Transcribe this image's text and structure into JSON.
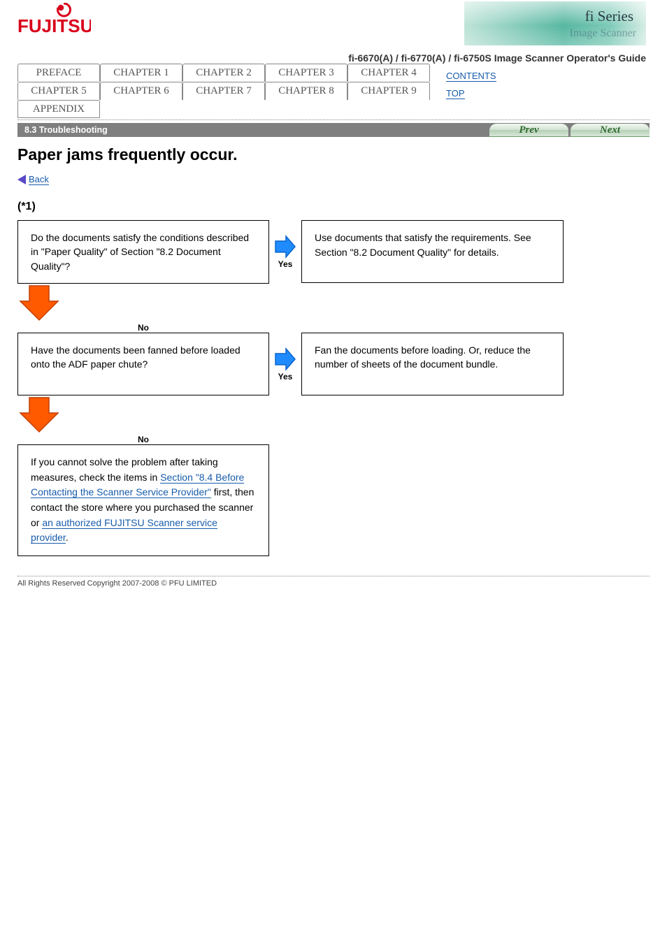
{
  "header": {
    "brand_text": "FUJITSU",
    "fiseries_brand": "fi Series",
    "fiseries_sub": "Image Scanner",
    "manual_title": "fi-6670(A) / fi-6770(A) / fi-6750S Image Scanner Operator's Guide"
  },
  "tabs": [
    "PREFACE",
    "CHAPTER 1",
    "CHAPTER 2",
    "CHAPTER 3",
    "CHAPTER 4",
    "CHAPTER 5",
    "CHAPTER 6",
    "CHAPTER 7",
    "CHAPTER 8",
    "CHAPTER 9",
    "APPENDIX"
  ],
  "side_links": {
    "contents": "CONTENTS",
    "top": "TOP"
  },
  "bar": {
    "title": "8.3 Troubleshooting",
    "prev": "Prev",
    "next": "Next"
  },
  "page": {
    "heading": "Paper jams frequently occur.",
    "back_label": "Back",
    "question_label": "(*1)",
    "box1_q": "Do the documents satisfy the conditions described in \"Paper Quality\" of Section \"8.2 Document Quality\"?",
    "box1_yes": "Yes",
    "box1_a": "Use documents that satisfy the requirements. See Section \"8.2 Document Quality\" for details.",
    "box1_no": "No",
    "box2_q": "Have the documents been fanned before loaded onto the ADF paper chute?",
    "box2_yes": "Yes",
    "box2_a": "Fan the documents before loading. Or, reduce the number of sheets of the document bundle.",
    "box2_no": "No",
    "box3_lead": "If you cannot solve the problem after taking measures, check the items in ",
    "box3_link1": "Section \"8.4 Before Contacting the Scanner Service Provider\"",
    "box3_mid": " first, then contact the store where you purchased the scanner or ",
    "box3_link2": "an authorized FUJITSU Scanner service provider"
  },
  "footer": {
    "copyright": "All Rights Reserved Copyright 2007-2008 © PFU LIMITED"
  }
}
